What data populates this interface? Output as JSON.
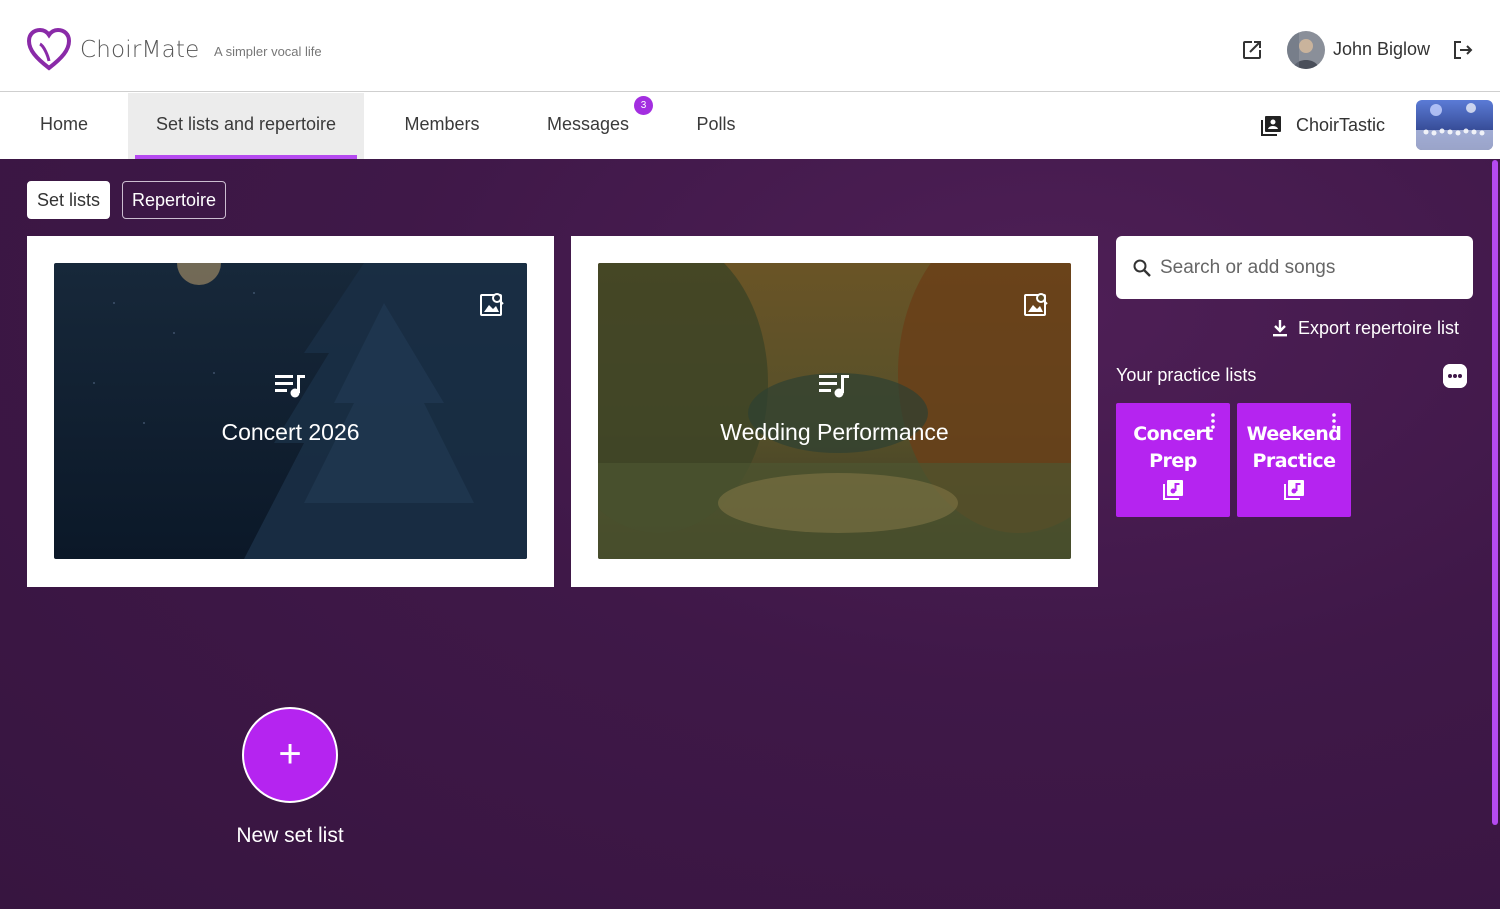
{
  "app": {
    "name": "ChoirMate",
    "tagline": "A simpler vocal life"
  },
  "user": {
    "name": "John Biglow"
  },
  "nav": {
    "items": [
      {
        "label": "Home"
      },
      {
        "label": "Set lists and repertoire",
        "active": true
      },
      {
        "label": "Members"
      },
      {
        "label": "Messages",
        "badge": "3"
      },
      {
        "label": "Polls"
      }
    ]
  },
  "choir": {
    "name": "ChoirTastic"
  },
  "toggles": {
    "set_lists": "Set lists",
    "repertoire": "Repertoire"
  },
  "setlists": [
    {
      "title": "Concert 2026"
    },
    {
      "title": "Wedding Performance"
    }
  ],
  "search": {
    "placeholder": "Search or add songs"
  },
  "export_label": "Export repertoire list",
  "practice": {
    "title": "Your practice lists",
    "lists": [
      {
        "name": "Concert Prep"
      },
      {
        "name": "Weekend Practice"
      }
    ]
  },
  "new_setlist_label": "New set list",
  "colors": {
    "accent": "#b524f0",
    "background": "#3f1848"
  }
}
